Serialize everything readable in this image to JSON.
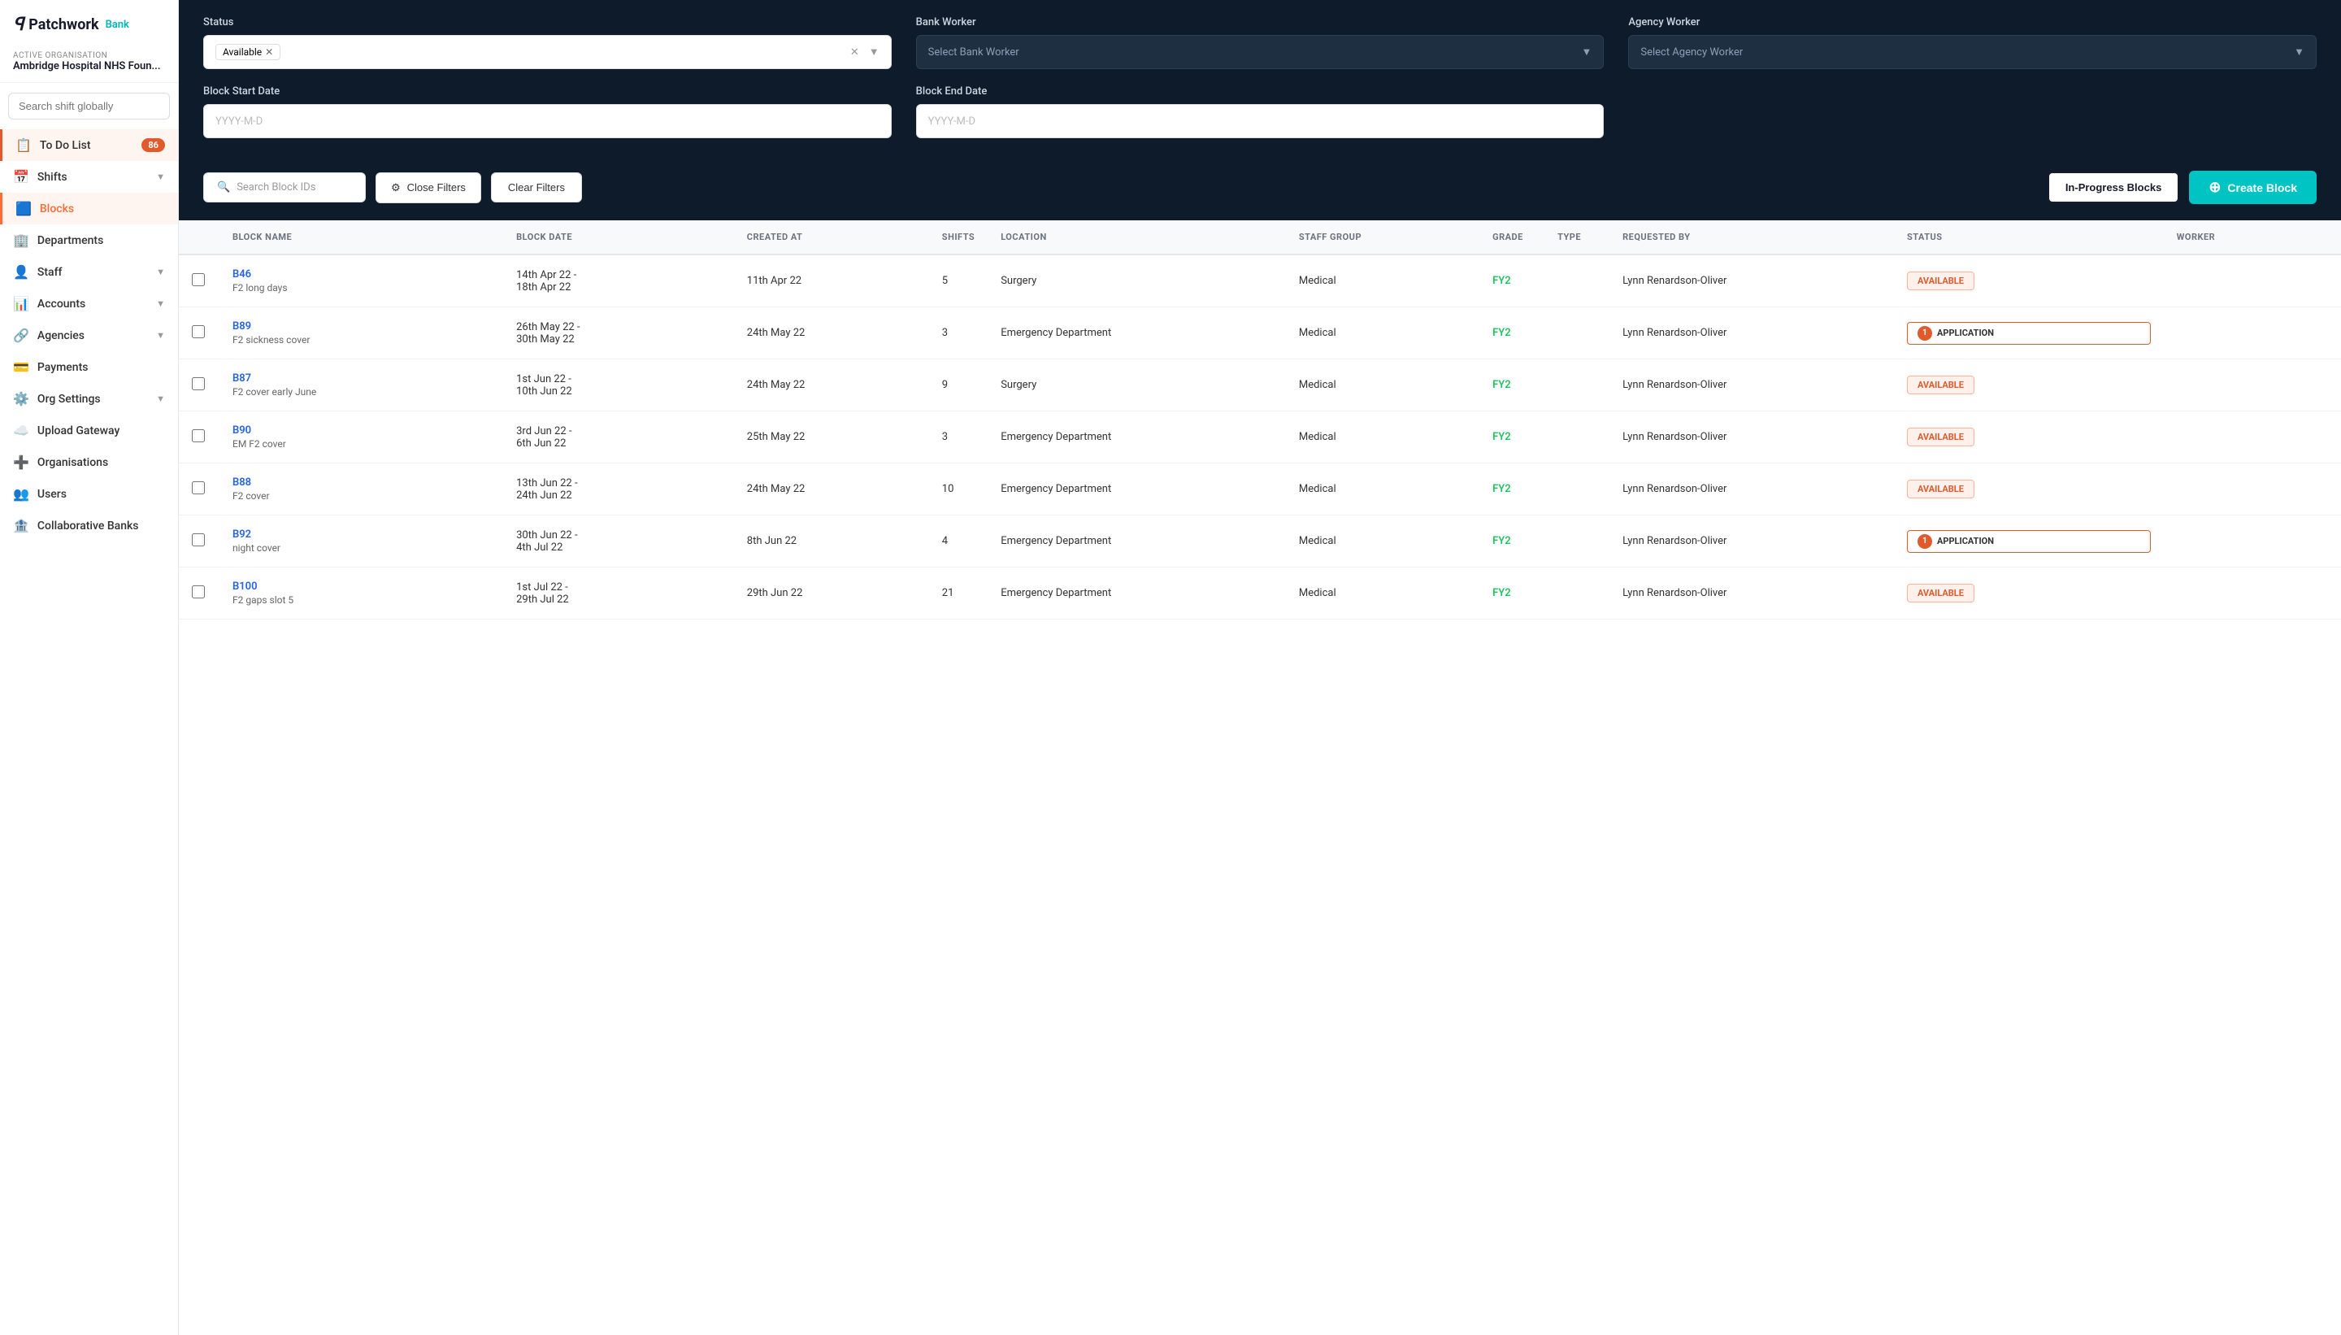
{
  "app": {
    "logo_text": "Patchwork",
    "logo_sub": "Bank"
  },
  "sidebar": {
    "active_org_label": "ACTIVE ORGANISATION",
    "active_org_name": "Ambridge Hospital NHS Foun...",
    "search_placeholder": "Search shift globally",
    "nav_items": [
      {
        "id": "todo",
        "label": "To Do List",
        "icon": "📋",
        "badge": "86",
        "active": false,
        "todo": true
      },
      {
        "id": "shifts",
        "label": "Shifts",
        "icon": "📅",
        "has_arrow": true
      },
      {
        "id": "blocks",
        "label": "Blocks",
        "icon": "🟦",
        "active": true
      },
      {
        "id": "departments",
        "label": "Departments",
        "icon": "🏢"
      },
      {
        "id": "staff",
        "label": "Staff",
        "icon": "👤",
        "has_arrow": true
      },
      {
        "id": "accounts",
        "label": "Accounts",
        "icon": "📊",
        "has_arrow": true
      },
      {
        "id": "agencies",
        "label": "Agencies",
        "icon": "🔗",
        "has_arrow": true
      },
      {
        "id": "payments",
        "label": "Payments",
        "icon": "💳"
      },
      {
        "id": "org-settings",
        "label": "Org Settings",
        "icon": "⚙️",
        "has_arrow": true
      },
      {
        "id": "upload-gateway",
        "label": "Upload Gateway",
        "icon": "☁️"
      },
      {
        "id": "organisations",
        "label": "Organisations",
        "icon": "➕"
      },
      {
        "id": "users",
        "label": "Users",
        "icon": "👥"
      },
      {
        "id": "collaborative-banks",
        "label": "Collaborative Banks",
        "icon": "🏦"
      }
    ]
  },
  "filters": {
    "status_label": "Status",
    "status_tag": "Available",
    "bank_worker_label": "Bank Worker",
    "bank_worker_placeholder": "Select Bank Worker",
    "agency_worker_label": "Agency Worker",
    "agency_worker_placeholder": "Select Agency Worker",
    "block_start_label": "Block Start Date",
    "block_start_placeholder": "YYYY-M-D",
    "block_end_label": "Block End Date",
    "block_end_placeholder": "YYYY-M-D"
  },
  "actions": {
    "search_placeholder": "Search Block IDs",
    "close_filters_label": "Close Filters",
    "clear_filters_label": "Clear Filters",
    "in_progress_label": "In-Progress Blocks",
    "create_block_label": "Create Block"
  },
  "table": {
    "columns": [
      "",
      "BLOCK NAME",
      "BLOCK DATE",
      "CREATED AT",
      "SHIFTS",
      "LOCATION",
      "STAFF GROUP",
      "GRADE",
      "TYPE",
      "REQUESTED BY",
      "STATUS",
      "WORKER"
    ],
    "rows": [
      {
        "id": "B46",
        "name": "F2 long days",
        "date_start": "14th Apr 22 -",
        "date_end": "18th Apr 22",
        "created_at": "11th Apr 22",
        "shifts": "5",
        "location": "Surgery",
        "staff_group": "Medical",
        "grade": "FY2",
        "type": "",
        "requested_by": "Lynn Renardson-Oliver",
        "status": "AVAILABLE",
        "status_type": "available",
        "worker": ""
      },
      {
        "id": "B89",
        "name": "F2 sickness cover",
        "date_start": "26th May 22 -",
        "date_end": "30th May 22",
        "created_at": "24th May 22",
        "shifts": "3",
        "location": "Emergency Department",
        "staff_group": "Medical",
        "grade": "FY2",
        "type": "",
        "requested_by": "Lynn Renardson-Oliver",
        "status": "APPLICATION",
        "status_type": "application",
        "app_count": "1",
        "worker": ""
      },
      {
        "id": "B87",
        "name": "F2 cover early June",
        "date_start": "1st Jun 22 -",
        "date_end": "10th Jun 22",
        "created_at": "24th May 22",
        "shifts": "9",
        "location": "Surgery",
        "staff_group": "Medical",
        "grade": "FY2",
        "type": "",
        "requested_by": "Lynn Renardson-Oliver",
        "status": "AVAILABLE",
        "status_type": "available",
        "worker": ""
      },
      {
        "id": "B90",
        "name": "EM F2 cover",
        "date_start": "3rd Jun 22 -",
        "date_end": "6th Jun 22",
        "created_at": "25th May 22",
        "shifts": "3",
        "location": "Emergency Department",
        "staff_group": "Medical",
        "grade": "FY2",
        "type": "",
        "requested_by": "Lynn Renardson-Oliver",
        "status": "AVAILABLE",
        "status_type": "available",
        "worker": ""
      },
      {
        "id": "B88",
        "name": "F2 cover",
        "date_start": "13th Jun 22 -",
        "date_end": "24th Jun 22",
        "created_at": "24th May 22",
        "shifts": "10",
        "location": "Emergency Department",
        "staff_group": "Medical",
        "grade": "FY2",
        "type": "",
        "requested_by": "Lynn Renardson-Oliver",
        "status": "AVAILABLE",
        "status_type": "available",
        "worker": ""
      },
      {
        "id": "B92",
        "name": "night cover",
        "date_start": "30th Jun 22 -",
        "date_end": "4th Jul 22",
        "created_at": "8th Jun 22",
        "shifts": "4",
        "location": "Emergency Department",
        "staff_group": "Medical",
        "grade": "FY2",
        "type": "",
        "requested_by": "Lynn Renardson-Oliver",
        "status": "APPLICATION",
        "status_type": "application",
        "app_count": "1",
        "worker": ""
      },
      {
        "id": "B100",
        "name": "F2 gaps slot 5",
        "date_start": "1st Jul 22 -",
        "date_end": "29th Jul 22",
        "created_at": "29th Jun 22",
        "shifts": "21",
        "location": "Emergency Department",
        "staff_group": "Medical",
        "grade": "FY2",
        "type": "",
        "requested_by": "Lynn Renardson-Oliver",
        "status": "AVAILABLE",
        "status_type": "available",
        "worker": ""
      }
    ]
  }
}
